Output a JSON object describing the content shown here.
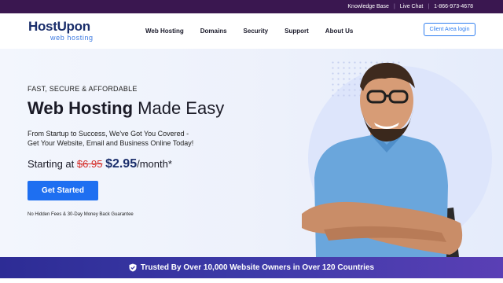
{
  "topbar": {
    "links": [
      "Knowledge Base",
      "Live Chat",
      "1-866-973-4678"
    ]
  },
  "logo": {
    "name": "HostUpon",
    "sub": "web hosting"
  },
  "nav": {
    "items": [
      "Web Hosting",
      "Domains",
      "Security",
      "Support",
      "About Us"
    ],
    "login": "Client Area login"
  },
  "hero": {
    "tagline": "FAST, SECURE & AFFORDABLE",
    "title_bold": "Web Hosting",
    "title_rest": "Made Easy",
    "desc_line1": "From Startup to Success, We've Got You Covered -",
    "desc_line2": "Get Your Website, Email and Business Online Today!",
    "price_prefix": "Starting at",
    "price_old": "$6.95",
    "price_new": "$2.95",
    "price_suffix": "/month*",
    "cta": "Get Started",
    "fine_print": "No Hidden Fees & 30-Day Money Back Guarantee"
  },
  "trust": {
    "text": "Trusted By Over 10,000 Website Owners in Over 120 Countries"
  },
  "colors": {
    "topbar": "#3a1750",
    "brand_navy": "#1a2e6b",
    "accent_blue": "#1e6ff1",
    "price_red": "#d5312c"
  },
  "icons": {
    "shield": "shield-check-icon"
  }
}
